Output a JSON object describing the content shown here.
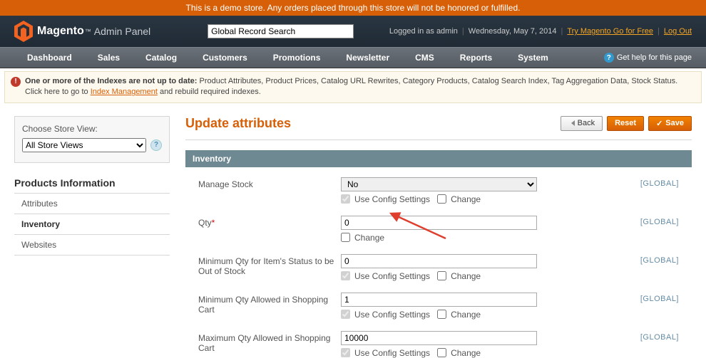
{
  "demo_banner": "This is a demo store. Any orders placed through this store will not be honored or fulfilled.",
  "logo": {
    "brand": "Magento",
    "sub": "Admin Panel"
  },
  "search": {
    "placeholder": "Global Record Search"
  },
  "header": {
    "logged_in": "Logged in as admin",
    "date": "Wednesday, May 7, 2014",
    "try_link": "Try Magento Go for Free",
    "logout": "Log Out"
  },
  "nav": [
    "Dashboard",
    "Sales",
    "Catalog",
    "Customers",
    "Promotions",
    "Newsletter",
    "CMS",
    "Reports",
    "System"
  ],
  "help_link": "Get help for this page",
  "notice": {
    "bold": "One or more of the Indexes are not up to date:",
    "rest": " Product Attributes, Product Prices, Catalog URL Rewrites, Category Products, Catalog Search Index, Tag Aggregation Data, Stock Status. Click here to go to ",
    "link": "Index Management",
    "tail": " and rebuild required indexes."
  },
  "sidebar": {
    "choose_label": "Choose Store View:",
    "store_option": "All Store Views",
    "heading": "Products Information",
    "tabs": [
      "Attributes",
      "Inventory",
      "Websites"
    ],
    "active": 1
  },
  "page": {
    "title": "Update attributes",
    "back": "Back",
    "reset": "Reset",
    "save": "Save",
    "section": "Inventory",
    "scope": "[GLOBAL]",
    "use_config": "Use Config Settings",
    "change": "Change",
    "rows": [
      {
        "label": "Manage Stock",
        "type": "select",
        "value": "No",
        "use_config": true,
        "change": true
      },
      {
        "label": "Qty",
        "required": true,
        "type": "text",
        "value": "0",
        "change_only": true
      },
      {
        "label": "Minimum Qty for Item's Status to be Out of Stock",
        "type": "text",
        "value": "0",
        "use_config": true,
        "change": true
      },
      {
        "label": "Minimum Qty Allowed in Shopping Cart",
        "type": "text",
        "value": "1",
        "use_config": true,
        "change": true
      },
      {
        "label": "Maximum Qty Allowed in Shopping Cart",
        "type": "text",
        "value": "10000",
        "use_config": true,
        "change": true
      }
    ]
  }
}
